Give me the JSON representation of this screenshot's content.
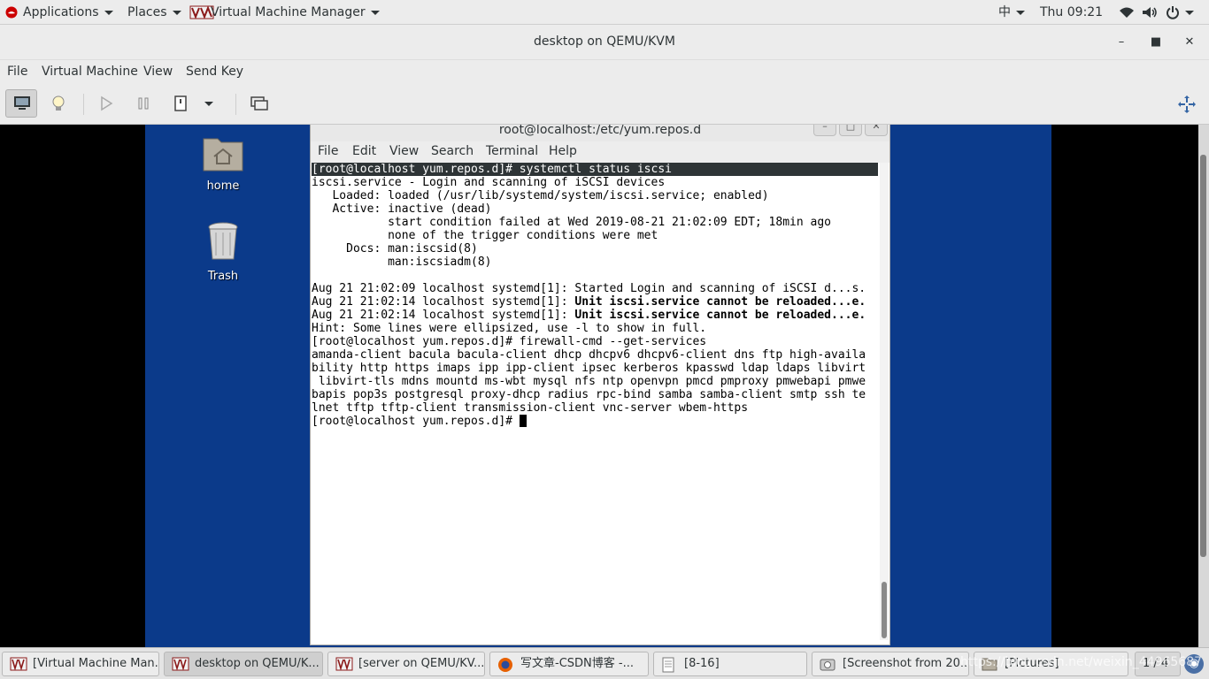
{
  "topbar": {
    "applications": "Applications",
    "places": "Places",
    "active_app": "Virtual Machine Manager",
    "input_method": "中",
    "clock": "Thu 09:21"
  },
  "window": {
    "title": "desktop on QEMU/KVM",
    "menu": [
      "File",
      "Virtual Machine",
      "View",
      "Send Key"
    ]
  },
  "guest": {
    "desktop_icons": [
      {
        "label": "home",
        "icon": "folder-home-icon"
      },
      {
        "label": "Trash",
        "icon": "trash-icon"
      }
    ],
    "terminal": {
      "title": "root@localhost:/etc/yum.repos.d",
      "menu": [
        "File",
        "Edit",
        "View",
        "Search",
        "Terminal",
        "Help"
      ],
      "lines": [
        {
          "text": "[root@localhost yum.repos.d]# systemctl status iscsi",
          "style": "inverse"
        },
        {
          "text": "iscsi.service - Login and scanning of iSCSI devices"
        },
        {
          "text": "   Loaded: loaded (/usr/lib/systemd/system/iscsi.service; enabled)"
        },
        {
          "text": "   Active: inactive (dead)"
        },
        {
          "text": "           start condition failed at Wed 2019-08-21 21:02:09 EDT; 18min ago"
        },
        {
          "text": "           none of the trigger conditions were met"
        },
        {
          "text": "     Docs: man:iscsid(8)"
        },
        {
          "text": "           man:iscsiadm(8)"
        },
        {
          "text": ""
        },
        {
          "text": "Aug 21 21:02:09 localhost systemd[1]: Started Login and scanning of iSCSI d...s."
        },
        {
          "prefix": "Aug 21 21:02:14 localhost systemd[1]: ",
          "bold": "Unit iscsi.service cannot be reloaded...e."
        },
        {
          "prefix": "Aug 21 21:02:14 localhost systemd[1]: ",
          "bold": "Unit iscsi.service cannot be reloaded...e."
        },
        {
          "text": "Hint: Some lines were ellipsized, use -l to show in full."
        },
        {
          "text": "[root@localhost yum.repos.d]# firewall-cmd --get-services"
        },
        {
          "text": "amanda-client bacula bacula-client dhcp dhcpv6 dhcpv6-client dns ftp high-availa"
        },
        {
          "text": "bility http https imaps ipp ipp-client ipsec kerberos kpasswd ldap ldaps libvirt"
        },
        {
          "text": " libvirt-tls mdns mountd ms-wbt mysql nfs ntp openvpn pmcd pmproxy pmwebapi pmwe"
        },
        {
          "text": "bapis pop3s postgresql proxy-dhcp radius rpc-bind samba samba-client smtp ssh te"
        },
        {
          "text": "lnet tftp tftp-client transmission-client vnc-server wbem-https"
        },
        {
          "text": "[root@localhost yum.repos.d]# ",
          "cursor": true
        }
      ]
    }
  },
  "taskbar": {
    "tasks": [
      {
        "label": "[Virtual Machine Man...",
        "icon": "vm-manager-icon",
        "active": false
      },
      {
        "label": "desktop on QEMU/K...",
        "icon": "vm-manager-icon",
        "active": true
      },
      {
        "label": "[server on QEMU/KV...",
        "icon": "vm-manager-icon",
        "active": false
      },
      {
        "label": "写文章-CSDN博客 -...",
        "icon": "firefox-icon",
        "active": false
      },
      {
        "label": "[8-16]",
        "icon": "document-icon",
        "active": false
      },
      {
        "label": "[Screenshot from 20...",
        "icon": "screenshot-icon",
        "active": false
      },
      {
        "label": "[Pictures]",
        "icon": "folder-icon",
        "active": false
      }
    ],
    "workspace": "1 / 4",
    "watermark": "https://blog.csdn.net/weixin_44965687"
  }
}
